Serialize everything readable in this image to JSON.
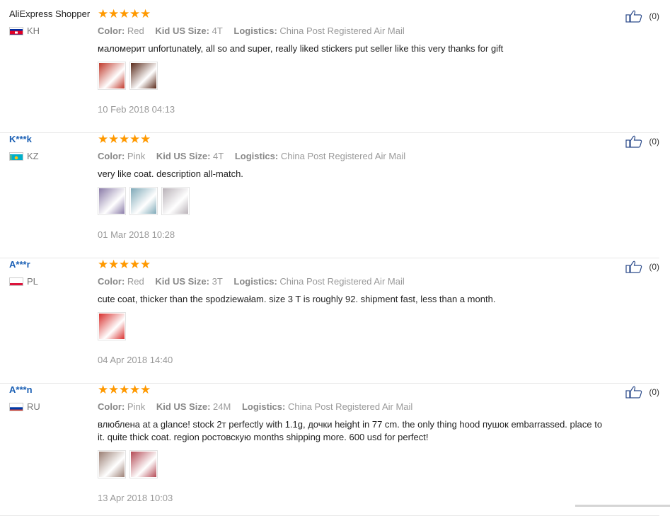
{
  "reviews": [
    {
      "user": "AliExpress Shopper",
      "country": "KH",
      "flag": "kh",
      "stars": 5,
      "color_label": "Color:",
      "color": "Red",
      "size_label": "Kid US Size:",
      "size": "4T",
      "logistics_label": "Logistics:",
      "logistics": "China Post Registered Air Mail",
      "text": "маломерит unfortunately, all so and super, really liked stickers put seller like this very thanks for gift",
      "photos": [
        "#c0392b",
        "#5a2a1a"
      ],
      "date": "10 Feb 2018 04:13",
      "helpful": "(0)"
    },
    {
      "user": "K***k",
      "country": "KZ",
      "flag": "kz",
      "stars": 5,
      "color_label": "Color:",
      "color": "Pink",
      "size_label": "Kid US Size:",
      "size": "4T",
      "logistics_label": "Logistics:",
      "logistics": "China Post Registered Air Mail",
      "text": "very like coat. description all-match.",
      "photos": [
        "#8a7ba8",
        "#7fa9b8",
        "#b9b2b8"
      ],
      "date": "01 Mar 2018 10:28",
      "helpful": "(0)"
    },
    {
      "user": "A***r",
      "country": "PL",
      "flag": "pl",
      "stars": 5,
      "color_label": "Color:",
      "color": "Red",
      "size_label": "Kid US Size:",
      "size": "3T",
      "logistics_label": "Logistics:",
      "logistics": "China Post Registered Air Mail",
      "text": "cute coat, thicker than the spodziewałam. size 3 T is roughly 92. shipment fast, less than a month.",
      "photos": [
        "#d8302e"
      ],
      "date": "04 Apr 2018 14:40",
      "helpful": "(0)"
    },
    {
      "user": "A***n",
      "country": "RU",
      "flag": "ru",
      "stars": 5,
      "color_label": "Color:",
      "color": "Pink",
      "size_label": "Kid US Size:",
      "size": "24M",
      "logistics_label": "Logistics:",
      "logistics": "China Post Registered Air Mail",
      "text": "влюблена at a glance! stock 2т perfectly with 1.1g, дочки height in 77 cm. the only thing hood пушок embarrassed. place to it. quite thick coat. region ростовскую months shipping more. 600 usd for perfect!",
      "photos": [
        "#9a7e73",
        "#b44a55"
      ],
      "date": "13 Apr 2018 10:03",
      "helpful": "(0)"
    }
  ],
  "colors": {
    "star": "#ff9900",
    "link": "#1a5fb4",
    "muted": "#999999"
  }
}
